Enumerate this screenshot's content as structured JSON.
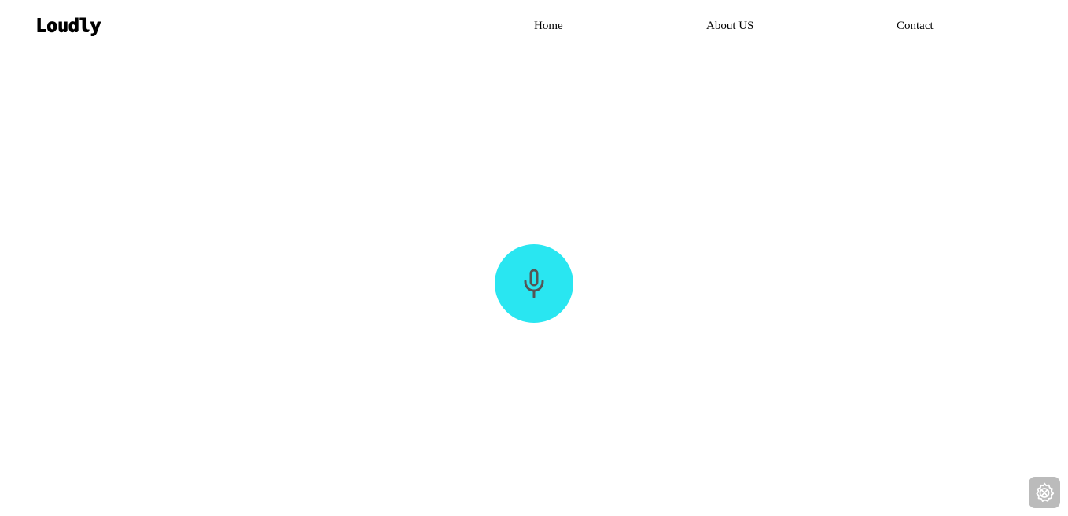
{
  "header": {
    "logo_text": "Loudly",
    "nav": {
      "home": "Home",
      "about": "About US",
      "contact": "Contact"
    }
  },
  "main": {
    "mic_button": {
      "icon": "microphone-icon",
      "background_color": "#29e6f1",
      "icon_color": "#555555"
    }
  },
  "corner_widget": {
    "icon": "settings-gear-icon",
    "background_color": "#b4b4b4"
  }
}
